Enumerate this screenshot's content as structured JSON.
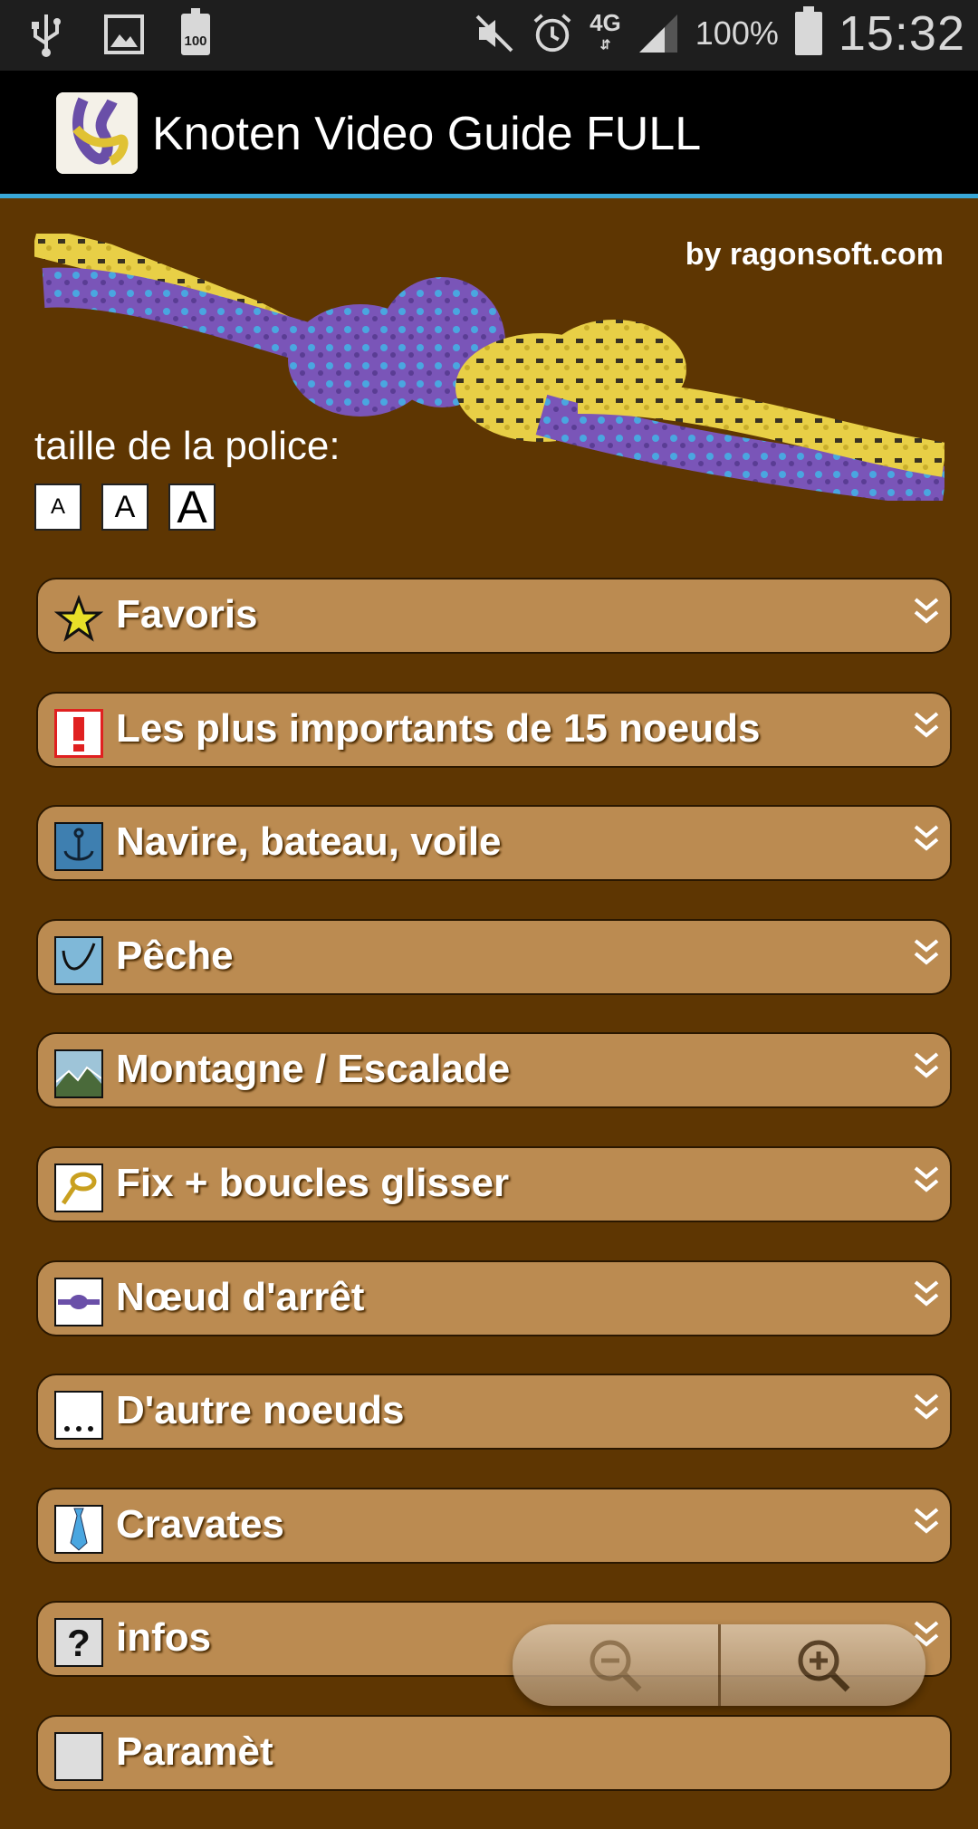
{
  "status_bar": {
    "battery_small": "100",
    "network": "4G",
    "battery_percent": "100%",
    "time": "15:32"
  },
  "app_bar": {
    "title": "Knoten Video Guide FULL"
  },
  "header": {
    "credit": "by ragonsoft.com",
    "font_size_label": "taille de la police:",
    "font_buttons": [
      "A",
      "A",
      "A"
    ]
  },
  "categories": [
    {
      "label": "Favoris",
      "icon": "star-icon"
    },
    {
      "label": "Les plus importants de 15 noeuds",
      "icon": "exclamation-icon"
    },
    {
      "label": "Navire, bateau, voile",
      "icon": "anchor-icon"
    },
    {
      "label": "Pêche",
      "icon": "fishing-hook-icon"
    },
    {
      "label": "Montagne / Escalade",
      "icon": "mountain-icon"
    },
    {
      "label": "Fix + boucles glisser",
      "icon": "loop-knot-icon"
    },
    {
      "label": "Nœud d'arrêt",
      "icon": "stopper-knot-icon"
    },
    {
      "label": "D'autre noeuds",
      "icon": "ellipsis-icon"
    },
    {
      "label": "Cravates",
      "icon": "tie-icon"
    },
    {
      "label": "infos",
      "icon": "question-icon"
    },
    {
      "label": "Paramèt",
      "icon": "settings-icon"
    }
  ],
  "colors": {
    "background": "#5e3602",
    "category_bar": "#bb8b51",
    "accent": "#39a7d7"
  }
}
